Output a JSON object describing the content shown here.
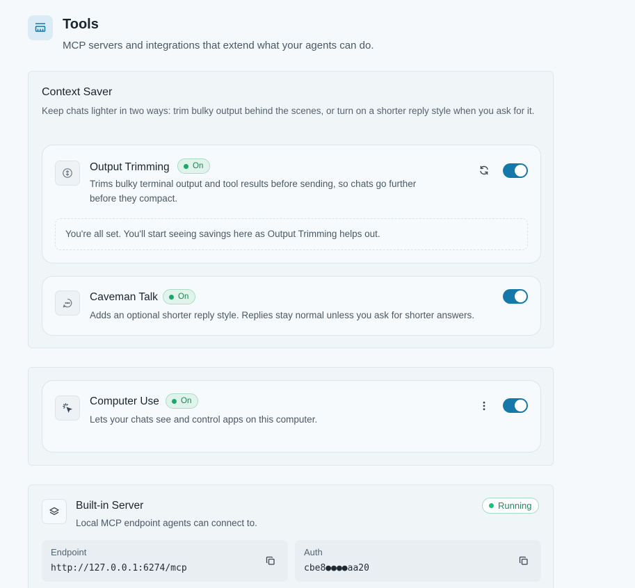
{
  "header": {
    "icon": "toolbox-icon",
    "title": "Tools",
    "subtitle": "MCP servers and integrations that extend what your agents can do."
  },
  "context_saver": {
    "title": "Context Saver",
    "description": "Keep chats lighter in two ways: trim bulky output behind the scenes, or turn on a shorter reply style when you ask for it.",
    "output_trimming": {
      "icon": "compress-icon",
      "name": "Output Trimming",
      "badge": "On",
      "description": "Trims bulky terminal output and tool results before sending, so chats go further before they compact.",
      "enabled": true,
      "action_icon": "refresh-icon",
      "notice": "You're all set. You'll start seeing savings here as Output Trimming helps out."
    },
    "caveman_talk": {
      "icon": "chat-bubble-icon",
      "name": "Caveman Talk",
      "badge": "On",
      "description": "Adds an optional shorter reply style. Replies stay normal unless you ask for shorter answers.",
      "enabled": true
    }
  },
  "computer_use": {
    "icon": "cursor-click-icon",
    "name": "Computer Use",
    "badge": "On",
    "description": "Lets your chats see and control apps on this computer.",
    "enabled": true,
    "action_icon": "more-vertical-icon"
  },
  "builtin_server": {
    "icon": "layers-icon",
    "name": "Built-in Server",
    "description": "Local MCP endpoint agents can connect to.",
    "status": "Running",
    "endpoint": {
      "label": "Endpoint",
      "value": "http://127.0.0.1:6274/mcp"
    },
    "auth": {
      "label": "Auth",
      "value": "cbe8●●●●aa20"
    }
  },
  "colors": {
    "accent": "#1478a8",
    "status_green": "#19a86a",
    "background": "#f5f9fc"
  }
}
